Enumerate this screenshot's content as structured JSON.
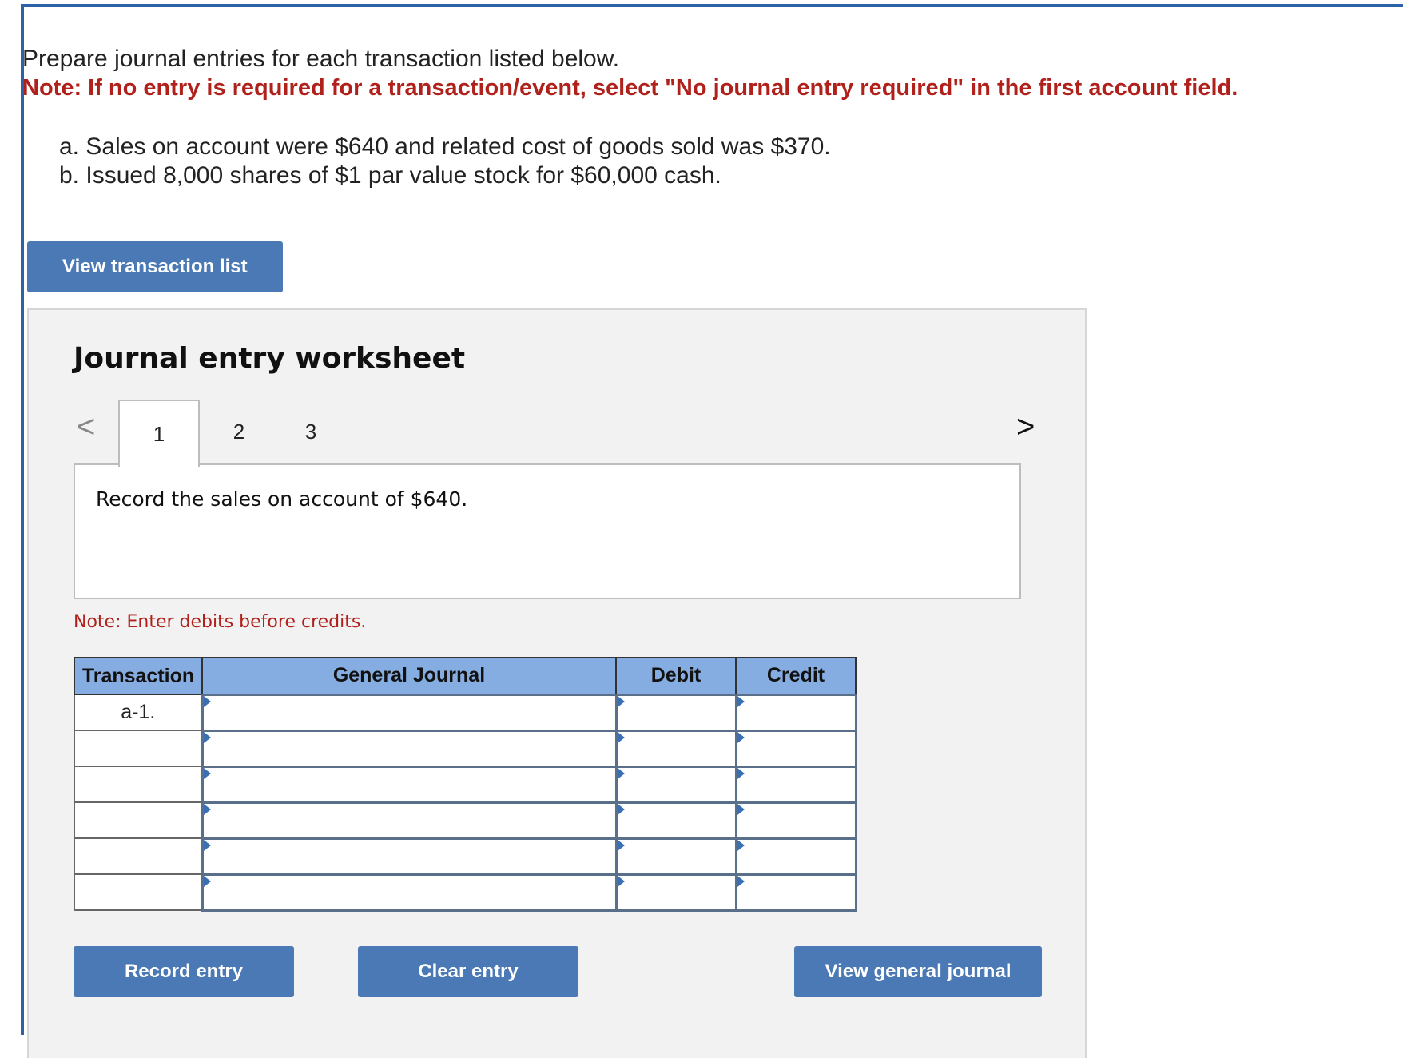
{
  "instructions": {
    "prompt": "Prepare journal entries for each transaction listed below.",
    "note": "Note: If no entry is required for a transaction/event, select \"No journal entry required\" in the first account field."
  },
  "transactions": [
    "a. Sales on account were $640 and related cost of goods sold was $370.",
    "b. Issued 8,000 shares of $1 par value stock for $60,000 cash."
  ],
  "buttons": {
    "view_transaction_list": "View transaction list",
    "record_entry": "Record entry",
    "clear_entry": "Clear entry",
    "view_general_journal": "View general journal"
  },
  "worksheet": {
    "title": "Journal entry worksheet",
    "prev_arrow": "<",
    "next_arrow": ">",
    "tabs": [
      "1",
      "2",
      "3"
    ],
    "active_tab": "1",
    "description": "Record the sales on account of $640.",
    "note": "Note: Enter debits before credits."
  },
  "journal_table": {
    "headers": [
      "Transaction",
      "General Journal",
      "Debit",
      "Credit"
    ],
    "rows": [
      {
        "transaction": "a-1.",
        "account": "",
        "debit": "",
        "credit": ""
      },
      {
        "transaction": "",
        "account": "",
        "debit": "",
        "credit": ""
      },
      {
        "transaction": "",
        "account": "",
        "debit": "",
        "credit": ""
      },
      {
        "transaction": "",
        "account": "",
        "debit": "",
        "credit": ""
      },
      {
        "transaction": "",
        "account": "",
        "debit": "",
        "credit": ""
      },
      {
        "transaction": "",
        "account": "",
        "debit": "",
        "credit": ""
      }
    ]
  },
  "colors": {
    "accent_blue": "#4a79b6",
    "header_blue": "#86ade2",
    "note_red": "#b0211b",
    "frame_blue": "#2e62a6"
  }
}
